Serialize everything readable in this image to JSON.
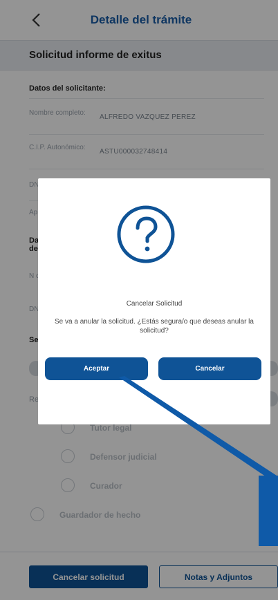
{
  "header": {
    "title": "Detalle del trámite",
    "back_icon": "chevron-left-icon"
  },
  "subheader": {
    "title": "Solicitud informe de exitus"
  },
  "applicant": {
    "section_title": "Datos del solicitante:",
    "fields": [
      {
        "label": "Nombre completo:",
        "value": "ALFREDO VAZQUEZ PEREZ"
      },
      {
        "label": "C.I.P. Autonómico:",
        "value": "ASTU000032748414"
      }
    ],
    "partial_labels": [
      "DN",
      "Ap"
    ]
  },
  "second_section": {
    "partial_title": "Da de"
  },
  "partial_rows": [
    "N c",
    "DN",
    "Se",
    "Re"
  ],
  "relationship_options": [
    {
      "label": "Tutor legal"
    },
    {
      "label": "Defensor judicial"
    },
    {
      "label": "Curador"
    },
    {
      "label": "Guardador de hecho"
    }
  ],
  "footer": {
    "cancel_label": "Cancelar solicitud",
    "notes_label": "Notas y Adjuntos"
  },
  "modal": {
    "icon": "question-circle-icon",
    "title": "Cancelar Solicitud",
    "message": "Se va a anular la solicitud. ¿Estás segura/o que deseas anular la solicitud?",
    "accept_label": "Aceptar",
    "cancel_label": "Cancelar"
  },
  "colors": {
    "brand": "#0f5396",
    "header_text": "#1a5ea8",
    "overlay": "rgba(0,0,0,0.42)",
    "annotation": "#0f5aa8"
  }
}
